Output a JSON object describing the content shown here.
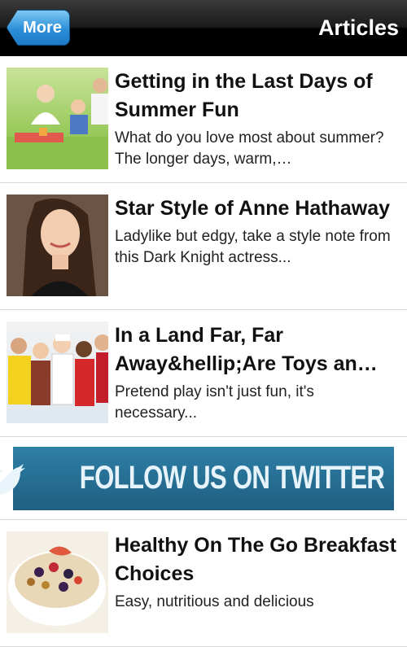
{
  "navbar": {
    "back_label": "More",
    "title": "Articles"
  },
  "articles": [
    {
      "title": "Getting in the Last Days of Summer Fun",
      "summary": "What do you love most about summer? The longer days, warm,…",
      "image": "family-picnic-photo"
    },
    {
      "title": "Star Style of Anne Hathaway",
      "summary": "Ladylike but edgy, take a style note from this Dark Knight actress...",
      "image": "celebrity-portrait-photo"
    },
    {
      "title": "In a Land Far, Far Away&hellip;Are Toys an…",
      "summary": "Pretend play isn't just fun, it's necessary...",
      "image": "kids-costumes-photo"
    },
    {
      "title": " Healthy On The Go Breakfast Choices",
      "summary": "Easy, nutritious and delicious",
      "image": "granola-bowl-photo"
    }
  ],
  "banner": {
    "text": "FOLLOW US ON TWITTER",
    "icon": "twitter-bird-icon"
  }
}
